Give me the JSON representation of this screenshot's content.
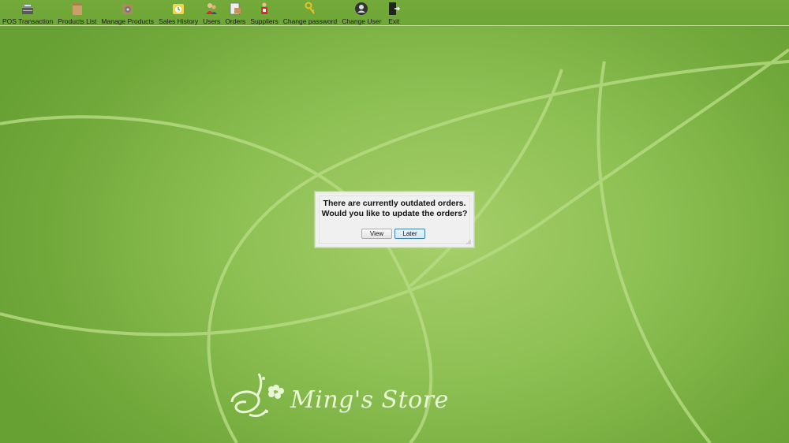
{
  "toolbar": {
    "items": [
      {
        "label": "POS Transaction",
        "icon": "cash-register-icon"
      },
      {
        "label": "Products List",
        "icon": "box-icon"
      },
      {
        "label": "Manage Products",
        "icon": "gear-box-icon"
      },
      {
        "label": "Sales History",
        "icon": "chart-icon"
      },
      {
        "label": "Users",
        "icon": "users-icon"
      },
      {
        "label": "Orders",
        "icon": "clipboard-icon"
      },
      {
        "label": "Suppliers",
        "icon": "supplier-icon"
      },
      {
        "label": "Change password",
        "icon": "key-icon"
      },
      {
        "label": "Change User",
        "icon": "user-circle-icon"
      },
      {
        "label": "Exit",
        "icon": "exit-door-icon"
      }
    ]
  },
  "dialog": {
    "message_line1": "There are currently outdated orders.",
    "message_line2": "Would you like to update the orders?",
    "view_label": "View",
    "later_label": "Later"
  },
  "brand": {
    "name": "Ming's Store"
  },
  "colors": {
    "background": "#8cbf52",
    "toolbar": "#6ea637",
    "accent_button_border": "#3c7fb1"
  }
}
